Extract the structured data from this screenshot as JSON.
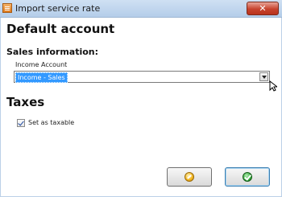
{
  "window": {
    "title": "Import service rate",
    "close_icon": "close-icon"
  },
  "main": {
    "heading": "Default account",
    "sales_section": "Sales information:",
    "income_account": {
      "label": "Income Account",
      "value": "Income - Sales"
    },
    "taxes_heading": "Taxes",
    "taxable_checkbox": {
      "label": "Set as taxable",
      "checked": true
    }
  },
  "buttons": {
    "cancel_icon": "cancel-icon",
    "ok_icon": "ok-check-icon"
  },
  "colors": {
    "selection": "#3399ff",
    "close_button": "#c7432e",
    "ok_icon": "#35a83a",
    "cancel_icon": "#f2b51f"
  }
}
